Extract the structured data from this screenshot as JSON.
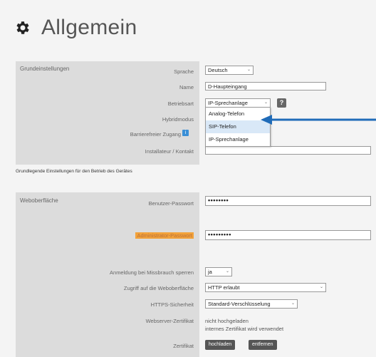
{
  "page": {
    "title": "Allgemein",
    "icon": "gear-icon"
  },
  "grundeinstellungen": {
    "section_title": "Grundeinstellungen",
    "fields": {
      "sprache": {
        "label": "Sprache",
        "value": "Deutsch"
      },
      "name": {
        "label": "Name",
        "value": "D-Haupteingang"
      },
      "betriebsart": {
        "label": "Betriebsart",
        "value": "IP-Sprechanlage",
        "help": "?"
      },
      "hybridmodus": {
        "label": "Hybridmodus"
      },
      "barrierefrei": {
        "label": "Barrierefreier Zugang",
        "info_icon": "i"
      },
      "installateur": {
        "label": "Installateur / Kontakt",
        "value": ""
      }
    },
    "dropdown_options": [
      "Analog-Telefon",
      "SIP-Telefon",
      "IP-Sprechanlage"
    ],
    "note": "Grundlegende Einstellungen für den Betrieb des Gerätes"
  },
  "weboberflaeche": {
    "section_title": "Weboberfläche",
    "fields": {
      "benutzer_passwort": {
        "label": "Benutzer-Passwort",
        "value": "••••••••"
      },
      "admin_passwort": {
        "label": "Administrator-Passwort",
        "value": "•••••••••"
      },
      "anmeldung_sperren": {
        "label": "Anmeldung bei Missbrauch sperren",
        "value": "ja"
      },
      "zugriff": {
        "label": "Zugriff auf die Weboberfläche",
        "value": "HTTP erlaubt"
      },
      "https": {
        "label": "HTTPS-Sicherheit",
        "value": "Standard-Verschlüsselung"
      },
      "zertifikat_status": {
        "label": "Webserver-Zertifikat",
        "line1": "nicht hochgeladen",
        "line2": "internes Zertifikat wird verwendet"
      },
      "zertifikat": {
        "label": "Zertifikat",
        "upload": "hochladen",
        "remove": "entfernen"
      }
    }
  },
  "colors": {
    "label_panel": "#dcdcdc",
    "highlight": "#f2a23a",
    "arrow": "#1f6bb8",
    "info": "#3a8fd6"
  }
}
